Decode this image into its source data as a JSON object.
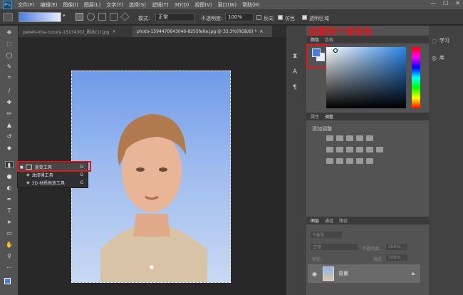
{
  "app": {
    "logo": "Ps"
  },
  "menu": [
    "文件(F)",
    "编辑(E)",
    "图像(I)",
    "图层(L)",
    "文字(Y)",
    "选择(S)",
    "滤镜(T)",
    "3D(D)",
    "视图(V)",
    "窗口(W)",
    "帮助(H)"
  ],
  "window_controls": {
    "minimize": "—",
    "maximize": "☐",
    "close": "✕"
  },
  "options_bar": {
    "mode_label": "模式:",
    "mode_value": "正常",
    "opacity_label": "不透明度:",
    "opacity_value": "100%",
    "reverse_label": "反向",
    "dither_label": "仿色",
    "transparency_label": "透明区域",
    "gradient_colors": [
      "#4a7de0",
      "#e8eefc"
    ]
  },
  "tabs": [
    {
      "label": "pexels-kha-ruxury-13134302_副本(1).jpg",
      "close": "✕"
    },
    {
      "label": "photo-1594470643046-8255fe0a.jpg @ 33.3%(RGB/8) *",
      "close": "✕"
    }
  ],
  "tool_flyout": {
    "items": [
      {
        "label": "渐变工具",
        "shortcut": "G",
        "selected": true
      },
      {
        "label": "油漆桶工具",
        "shortcut": "G"
      },
      {
        "label": "3D 材质拖放工具",
        "shortcut": "G"
      }
    ]
  },
  "annotation": "设置两个渐变色",
  "color_panel": {
    "tabs": [
      "颜色",
      "色板"
    ],
    "foreground": "#4a7de0",
    "background": "#e8eefc"
  },
  "adjustments_panel": {
    "tabs": [
      "属性",
      "调整"
    ],
    "add_label": "添加调整"
  },
  "layers_panel": {
    "tabs": [
      "图层",
      "通道",
      "路径"
    ],
    "kind_label": "类型",
    "blend_mode": "正常",
    "opacity_label": "不透明度:",
    "opacity_value": "100%",
    "lock_label": "锁定:",
    "fill_label": "填充:",
    "fill_value": "100%",
    "layer_name": "背景"
  },
  "learn_panel": {
    "learn": "学习",
    "library": "库"
  },
  "colors": {
    "accent_red": "#e5161b",
    "ps_blue": "#31a8ff"
  }
}
